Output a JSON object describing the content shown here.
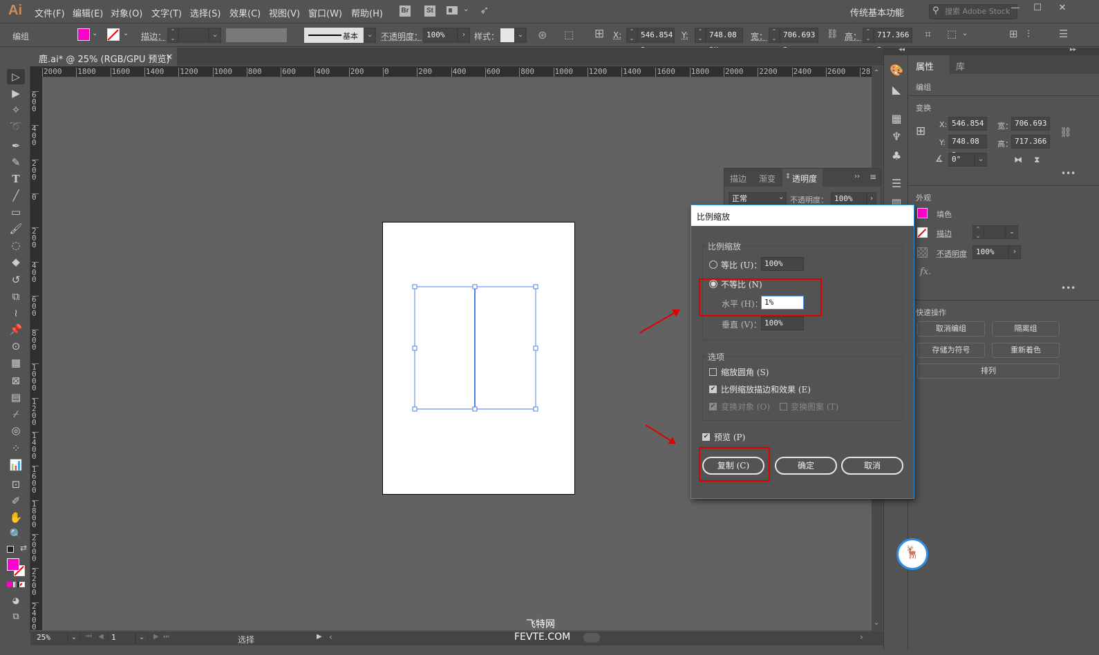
{
  "app": {
    "logo": "Ai"
  },
  "menu": [
    "文件(F)",
    "编辑(E)",
    "对象(O)",
    "文字(T)",
    "选择(S)",
    "效果(C)",
    "视图(V)",
    "窗口(W)",
    "帮助(H)"
  ],
  "top_icons": {
    "br": "Br",
    "st": "St"
  },
  "workspace": "传统基本功能",
  "stock_search_placeholder": "搜索 Adobe Stock",
  "window_controls": {
    "minimize": "—",
    "maximize": "☐",
    "close": "✕"
  },
  "control_bar": {
    "selection_type": "编组",
    "stroke_label": "描边：",
    "stroke_style": "基本",
    "opacity_label": "不透明度：",
    "opacity_value": "100%",
    "style_label": "样式：",
    "x_label": "X:",
    "x_value": "546.854 p",
    "y_label": "Y:",
    "y_value": "748.08 px",
    "w_label": "宽：",
    "w_value": "706.693 p",
    "h_label": "高：",
    "h_value": "717.366 p",
    "fill_color": "#ff00cc"
  },
  "document_tab": {
    "title": "鹿.ai* @ 25% (RGB/GPU 预览)",
    "close": "×"
  },
  "ruler_h": [
    "2000",
    "1800",
    "1600",
    "1400",
    "1200",
    "1000",
    "800",
    "600",
    "400",
    "200",
    "0",
    "200",
    "400",
    "600",
    "800",
    "1000",
    "1200",
    "1400",
    "1600",
    "1800",
    "2000",
    "2200",
    "2400",
    "2600",
    "28"
  ],
  "ruler_v": [
    "600",
    "400",
    "200",
    "0",
    "200",
    "400",
    "600",
    "800",
    "1000",
    "1200",
    "1400",
    "1600",
    "1800",
    "2000",
    "2200",
    "2400"
  ],
  "status_bar": {
    "zoom": "25%",
    "page": "1",
    "tool": "选择"
  },
  "watermark": {
    "line1": "飞特网",
    "line2": "FEVTE.COM"
  },
  "properties_panel": {
    "tabs": [
      "属性",
      "库"
    ],
    "object_type": "编组",
    "transform_title": "变换",
    "x_label": "X:",
    "x_value": "546.854",
    "y_label": "Y:",
    "y_value": "748.08 p",
    "w_label": "宽：",
    "w_value": "706.693",
    "h_label": "高：",
    "h_value": "717.366",
    "angle_value": "0°",
    "appearance_title": "外观",
    "fill_label": "填色",
    "stroke_label": "描边",
    "opacity_label": "不透明度",
    "opacity_value": "100%",
    "fx_label": "fx.",
    "quick_actions_title": "快速操作",
    "buttons": [
      "取消编组",
      "隔离组",
      "存储为符号",
      "重新着色",
      "排列"
    ]
  },
  "transparency_panel": {
    "tabs": [
      "描边",
      "渐变",
      "透明度"
    ],
    "blend_mode": "正常",
    "opacity_label": "不透明度：",
    "opacity_value": "100%"
  },
  "scale_dialog": {
    "title": "比例缩放",
    "group_scale": "比例缩放",
    "uniform_label": "等比 (U)：",
    "uniform_value": "100%",
    "uniform_selected": false,
    "non_uniform_label": "不等比 (N)",
    "non_uniform_selected": true,
    "horizontal_label": "水平 (H)：",
    "horizontal_value": "1%",
    "vertical_label": "垂直 (V)：",
    "vertical_value": "100%",
    "group_options": "选项",
    "scale_corners_label": "缩放圆角 (S)",
    "scale_corners_checked": false,
    "scale_strokes_label": "比例缩放描边和效果 (E)",
    "scale_strokes_checked": true,
    "transform_objects_label": "变换对象 (O)",
    "transform_objects_checked": true,
    "transform_patterns_label": "变换图案 (T)",
    "transform_patterns_checked": false,
    "preview_label": "预览 (P)",
    "preview_checked": true,
    "copy_button": "复制 (C)",
    "ok_button": "确定",
    "cancel_button": "取消"
  },
  "annotation_color": "#e00000",
  "selection_color": "#4a7ff0"
}
